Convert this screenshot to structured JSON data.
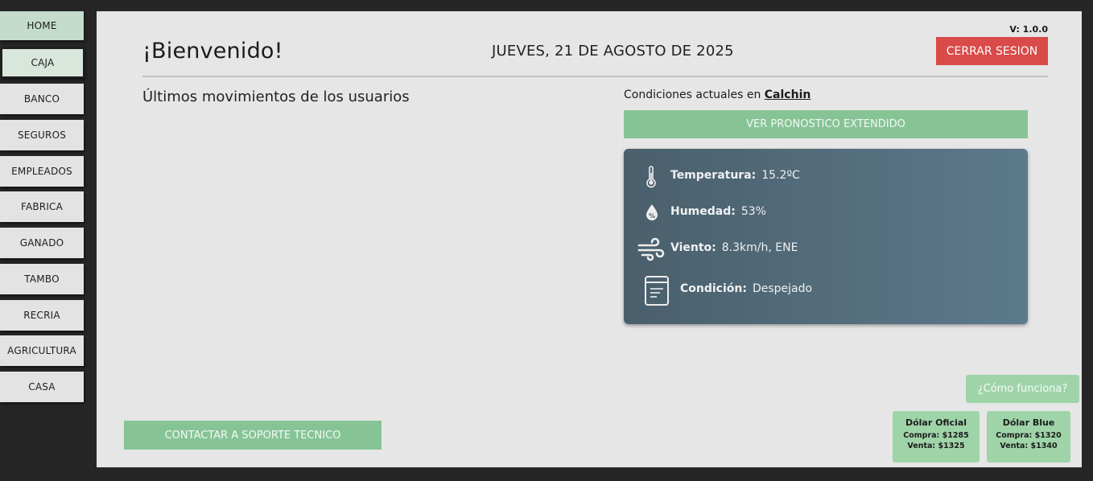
{
  "sidebar": {
    "items": [
      {
        "label": "HOME"
      },
      {
        "label": "CAJA"
      },
      {
        "label": "BANCO"
      },
      {
        "label": "SEGUROS"
      },
      {
        "label": "EMPLEADOS"
      },
      {
        "label": "FABRICA"
      },
      {
        "label": "GANADO"
      },
      {
        "label": "TAMBO"
      },
      {
        "label": "RECRIA"
      },
      {
        "label": "AGRICULTURA"
      },
      {
        "label": "CASA"
      }
    ]
  },
  "header": {
    "welcome": "¡Bienvenido!",
    "date": "JUEVES, 21 DE AGOSTO DE 2025",
    "version": "V: 1.0.0",
    "logout_label": "CERRAR SESION"
  },
  "movements": {
    "title": "Últimos movimientos de los usuarios"
  },
  "weather": {
    "title_prefix": "Condiciones actuales en",
    "city": "Calchin",
    "forecast_label": "VER PRONOSTICO EXTENDIDO",
    "temperature": {
      "label": "Temperatura:",
      "value": "15.2ºC",
      "icon": "thermometer-icon"
    },
    "humidity": {
      "label": "Humedad:",
      "value": "53%",
      "icon": "humidity-drop-icon"
    },
    "wind": {
      "label": "Viento:",
      "value": "8.3km/h, ENE",
      "icon": "wind-icon"
    },
    "condition": {
      "label": "Condición:",
      "value": "Despejado",
      "icon": "notepad-icon"
    }
  },
  "support_label": "CONTACTAR A SOPORTE TECNICO",
  "help_label": "¿Cómo funciona?",
  "dollars": {
    "oficial": {
      "title": "Dólar Oficial",
      "buy": "Compra: $1285",
      "sell": "Venta: $1325"
    },
    "blue": {
      "title": "Dólar Blue",
      "buy": "Compra: $1320",
      "sell": "Venta: $1340"
    }
  },
  "colors": {
    "accent_green": "#86c495",
    "logout_red": "#d94a48",
    "weather_card": "#4a5f6c"
  }
}
